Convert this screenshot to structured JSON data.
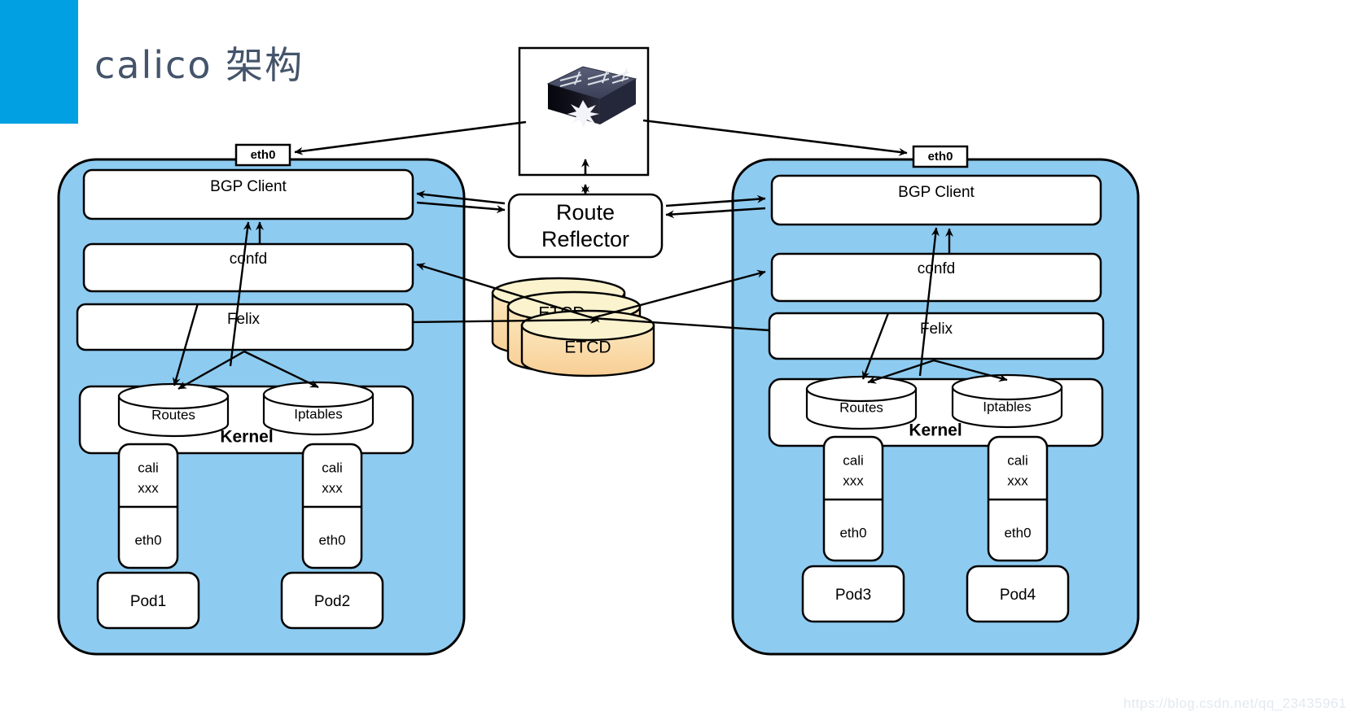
{
  "slide": {
    "title": "calico  架构",
    "accent_color": "#00A0E3",
    "title_color": "#44546A",
    "watermark": "https://blog.csdn.net/qq_23435961"
  },
  "colors": {
    "host_fill": "#8ECBF0",
    "box_fill": "#FFFFFF",
    "stroke": "#000000",
    "etcd_top": "#FAF3CE",
    "etcd_body": "#FAD9A5",
    "switch_top": "#4A4F66",
    "switch_front": "#0B0B14"
  },
  "center": {
    "switch": {
      "name": "network-switch",
      "label": ""
    },
    "route_reflector": {
      "line1": "Route",
      "line2": "Reflector"
    },
    "etcd_stack": [
      {
        "label": "ETCD"
      },
      {
        "label": "ETCD"
      },
      {
        "label": "ETCD"
      }
    ]
  },
  "hosts": [
    {
      "id": "host-left",
      "nic": "eth0",
      "components": [
        {
          "label": "BGP Client"
        },
        {
          "label": "confd"
        },
        {
          "label": "Felix"
        }
      ],
      "kernel": {
        "label": "Kernel",
        "stores": [
          {
            "label": "Routes"
          },
          {
            "label": "Iptables"
          }
        ]
      },
      "pods": [
        {
          "veth_line1": "cali",
          "veth_line2": "xxx",
          "iface": "eth0",
          "name": "Pod1"
        },
        {
          "veth_line1": "cali",
          "veth_line2": "xxx",
          "iface": "eth0",
          "name": "Pod2"
        }
      ]
    },
    {
      "id": "host-right",
      "nic": "eth0",
      "components": [
        {
          "label": "BGP Client"
        },
        {
          "label": "confd"
        },
        {
          "label": "Felix"
        }
      ],
      "kernel": {
        "label": "Kernel",
        "stores": [
          {
            "label": "Routes"
          },
          {
            "label": "Iptables"
          }
        ]
      },
      "pods": [
        {
          "veth_line1": "cali",
          "veth_line2": "xxx",
          "iface": "eth0",
          "name": "Pod3"
        },
        {
          "veth_line1": "cali",
          "veth_line2": "xxx",
          "iface": "eth0",
          "name": "Pod4"
        }
      ]
    }
  ]
}
